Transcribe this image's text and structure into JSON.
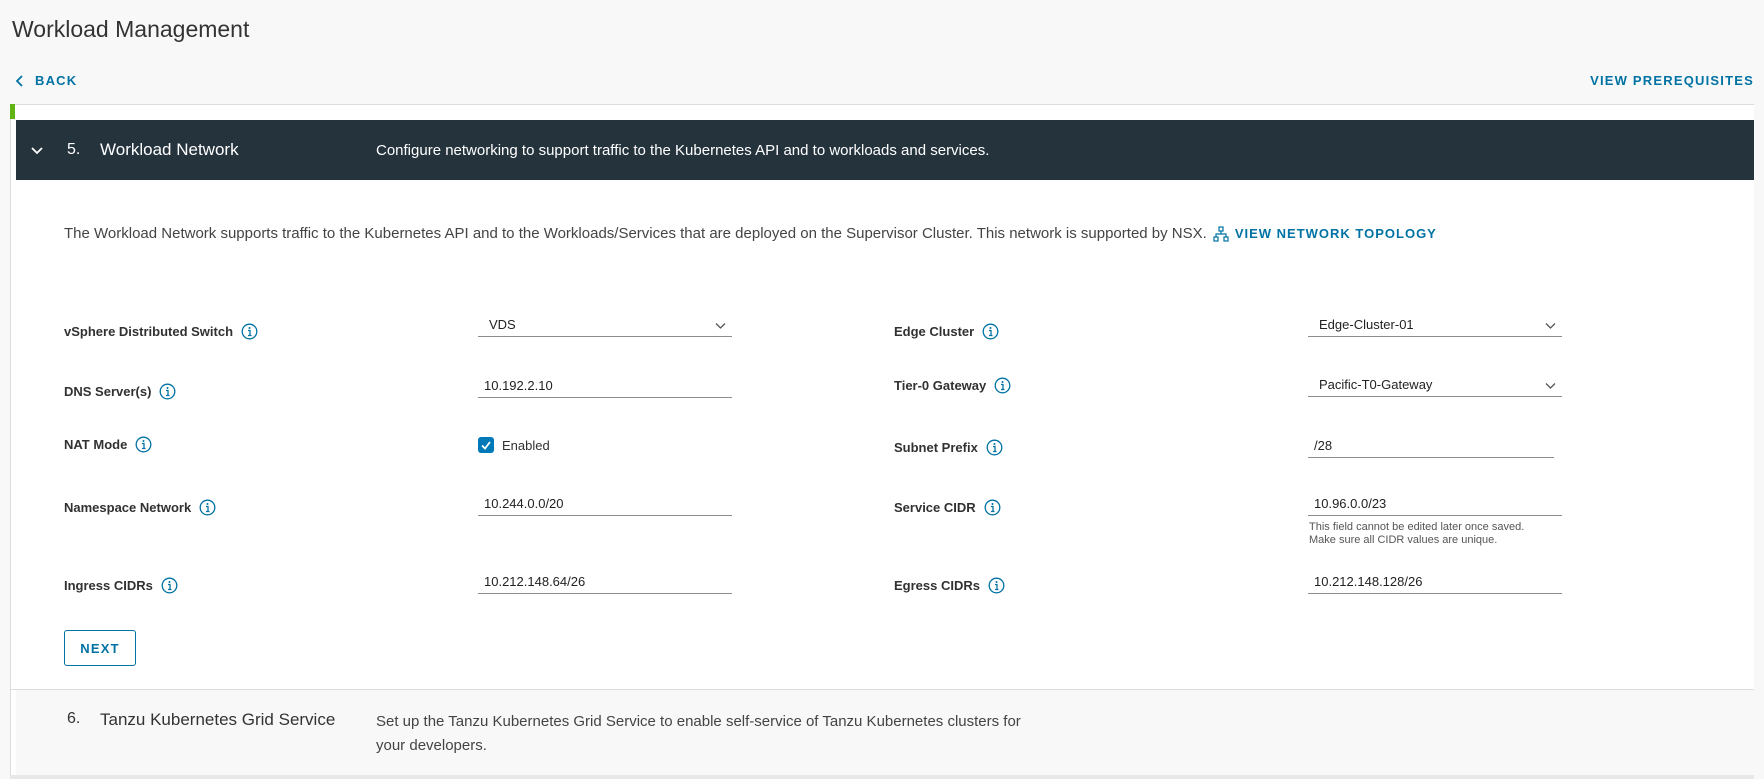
{
  "page": {
    "title": "Workload Management",
    "back_label": "BACK",
    "prereq_label": "VIEW PREREQUISITES"
  },
  "step": {
    "number": "5.",
    "name": "Workload Network",
    "description": "Configure networking to support traffic to the Kubernetes API and to workloads and services."
  },
  "intro": {
    "text": "The Workload Network supports traffic to the Kubernetes API and to the Workloads/Services that are deployed on the Supervisor Cluster. This network is supported by NSX.",
    "topology_link": "VIEW NETWORK TOPOLOGY"
  },
  "form": {
    "vds_label": "vSphere Distributed Switch",
    "vds_value": "VDS",
    "dns_label": "DNS Server(s)",
    "dns_value": "10.192.2.10",
    "nat_label": "NAT Mode",
    "nat_checkbox_label": "Enabled",
    "ns_label": "Namespace Network",
    "ns_value": "10.244.0.0/20",
    "ingress_label": "Ingress CIDRs",
    "ingress_value": "10.212.148.64/26",
    "edge_label": "Edge Cluster",
    "edge_value": "Edge-Cluster-01",
    "tier0_label": "Tier-0 Gateway",
    "tier0_value": "Pacific-T0-Gateway",
    "subnet_label": "Subnet Prefix",
    "subnet_value": "/28",
    "service_label": "Service CIDR",
    "service_value": "10.96.0.0/23",
    "service_helper_1": "This field cannot be edited later once saved.",
    "service_helper_2": "Make sure all CIDR values are unique.",
    "egress_label": "Egress CIDRs",
    "egress_value": "10.212.148.128/26",
    "next_label": "NEXT"
  },
  "next_step": {
    "number": "6.",
    "name": "Tanzu Kubernetes Grid Service",
    "description": "Set up the Tanzu Kubernetes Grid Service to enable self-service of Tanzu Kubernetes clusters for your developers."
  },
  "colors": {
    "header_bg": "#25333d",
    "link": "#0072a3",
    "checkbox": "#0079b8",
    "progress_green": "#60b515"
  }
}
